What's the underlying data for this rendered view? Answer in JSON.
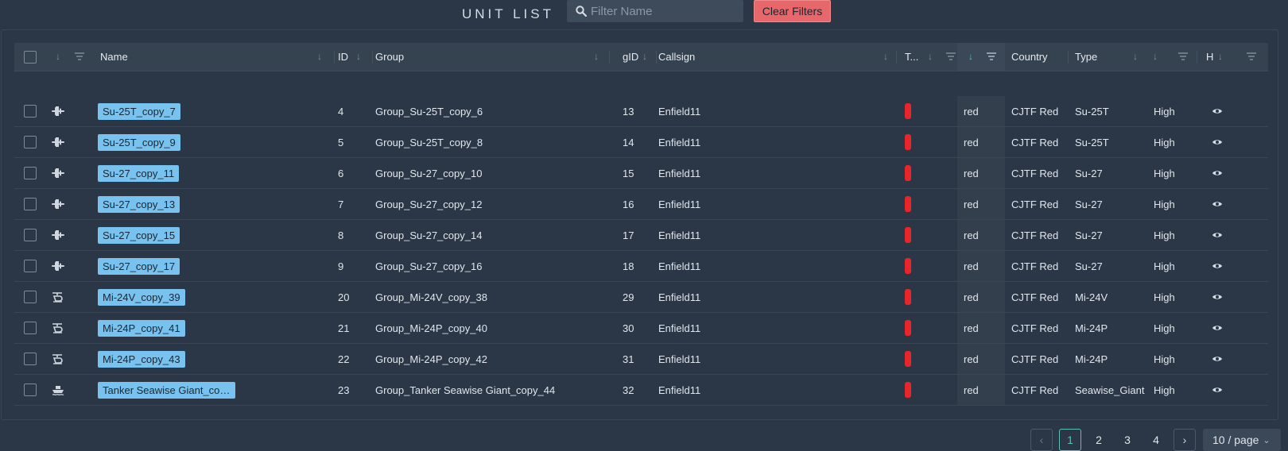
{
  "header": {
    "title": "UNIT LIST",
    "search_placeholder": "Filter Name",
    "search_value": "",
    "clear_label": "Clear Filters"
  },
  "columns": {
    "name": "Name",
    "id": "ID",
    "group": "Group",
    "gid": "gID",
    "callsign": "Callsign",
    "t": "T...",
    "country": "Country",
    "type": "Type",
    "h": "H"
  },
  "rows": [
    {
      "kind": "plane-icon",
      "name": "Su-25T_copy_7",
      "id": "4",
      "group": "Group_Su-25T_copy_6",
      "gid": "13",
      "callsign": "Enfield11",
      "coalition": "red",
      "country": "CJTF Red",
      "type": "Su-25T",
      "skill": "High",
      "color": "#e8262a"
    },
    {
      "kind": "plane-icon",
      "name": "Su-25T_copy_9",
      "id": "5",
      "group": "Group_Su-25T_copy_8",
      "gid": "14",
      "callsign": "Enfield11",
      "coalition": "red",
      "country": "CJTF Red",
      "type": "Su-25T",
      "skill": "High",
      "color": "#e8262a"
    },
    {
      "kind": "plane-icon",
      "name": "Su-27_copy_11",
      "id": "6",
      "group": "Group_Su-27_copy_10",
      "gid": "15",
      "callsign": "Enfield11",
      "coalition": "red",
      "country": "CJTF Red",
      "type": "Su-27",
      "skill": "High",
      "color": "#e8262a"
    },
    {
      "kind": "plane-icon",
      "name": "Su-27_copy_13",
      "id": "7",
      "group": "Group_Su-27_copy_12",
      "gid": "16",
      "callsign": "Enfield11",
      "coalition": "red",
      "country": "CJTF Red",
      "type": "Su-27",
      "skill": "High",
      "color": "#e8262a"
    },
    {
      "kind": "plane-icon",
      "name": "Su-27_copy_15",
      "id": "8",
      "group": "Group_Su-27_copy_14",
      "gid": "17",
      "callsign": "Enfield11",
      "coalition": "red",
      "country": "CJTF Red",
      "type": "Su-27",
      "skill": "High",
      "color": "#e8262a"
    },
    {
      "kind": "plane-icon",
      "name": "Su-27_copy_17",
      "id": "9",
      "group": "Group_Su-27_copy_16",
      "gid": "18",
      "callsign": "Enfield11",
      "coalition": "red",
      "country": "CJTF Red",
      "type": "Su-27",
      "skill": "High",
      "color": "#e8262a"
    },
    {
      "kind": "helicopter-icon",
      "name": "Mi-24V_copy_39",
      "id": "20",
      "group": "Group_Mi-24V_copy_38",
      "gid": "29",
      "callsign": "Enfield11",
      "coalition": "red",
      "country": "CJTF Red",
      "type": "Mi-24V",
      "skill": "High",
      "color": "#e8262a"
    },
    {
      "kind": "helicopter-icon",
      "name": "Mi-24P_copy_41",
      "id": "21",
      "group": "Group_Mi-24P_copy_40",
      "gid": "30",
      "callsign": "Enfield11",
      "coalition": "red",
      "country": "CJTF Red",
      "type": "Mi-24P",
      "skill": "High",
      "color": "#e8262a"
    },
    {
      "kind": "helicopter-icon",
      "name": "Mi-24P_copy_43",
      "id": "22",
      "group": "Group_Mi-24P_copy_42",
      "gid": "31",
      "callsign": "Enfield11",
      "coalition": "red",
      "country": "CJTF Red",
      "type": "Mi-24P",
      "skill": "High",
      "color": "#e8262a"
    },
    {
      "kind": "ship-icon",
      "name": "Tanker Seawise Giant_copy...",
      "id": "23",
      "group": "Group_Tanker Seawise Giant_copy_44",
      "gid": "32",
      "callsign": "Enfield11",
      "coalition": "red",
      "country": "CJTF Red",
      "type": "Seawise_Giant",
      "skill": "High",
      "color": "#e8262a"
    }
  ],
  "pagination": {
    "pages": [
      "1",
      "2",
      "3",
      "4"
    ],
    "current": "1",
    "page_size": "10 / page"
  },
  "colors": {
    "accent": "#5cc1b3",
    "clear_button": "#e8676a",
    "name_tag": "#78c2ef",
    "coalition_red": "#e8262a"
  }
}
